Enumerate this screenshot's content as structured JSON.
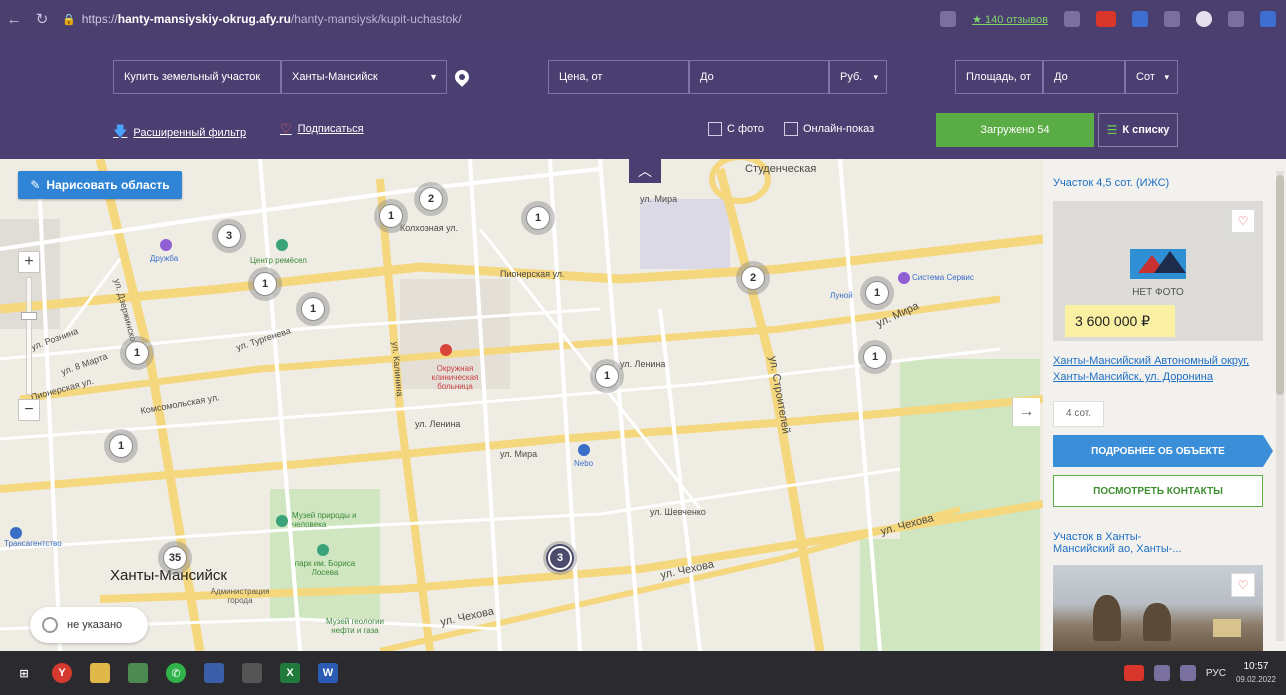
{
  "browser": {
    "url_prefix": "https://",
    "url_host": "hanty-mansiyskiy-okrug.afy.ru",
    "url_path": "/hanty-mansiysk/kupit-uchastok/",
    "reviews_label": "★ 140 отзывов"
  },
  "filters": {
    "deal_type": "Купить земельный участок",
    "city": "Ханты-Мансийск",
    "price_from_placeholder": "Цена, от",
    "price_to_placeholder": "До",
    "currency": "Руб.",
    "area_from_placeholder": "Площадь, от",
    "area_to_placeholder": "До",
    "area_unit": "Сот",
    "advanced_filter": "Расширенный фильтр",
    "subscribe": "Подписаться",
    "with_photo": "С фото",
    "online_show": "Онлайн-показ",
    "loaded_label": "Загружено 54",
    "to_list": "К списку"
  },
  "map": {
    "draw_area": "Нарисовать область",
    "city_label": "Ханты-Мансийск",
    "status_label": "не указано",
    "clusters": [
      {
        "count": "3"
      },
      {
        "count": "2"
      },
      {
        "count": "1"
      },
      {
        "count": "1"
      },
      {
        "count": "1"
      },
      {
        "count": "1"
      },
      {
        "count": "2"
      },
      {
        "count": "1"
      },
      {
        "count": "1"
      },
      {
        "count": "1"
      },
      {
        "count": "1"
      },
      {
        "count": "1"
      },
      {
        "count": "35"
      },
      {
        "count": "3"
      }
    ],
    "streets": {
      "pionerskaya": "Пионерская ул.",
      "studencheskaya": "Студенческая",
      "kolkhoznaya": "Колхозная ул.",
      "mira1": "ул. Мира",
      "mira2": "ул. Мира",
      "chekhova1": "ул. Чехова",
      "chekhova2": "ул. Чехова",
      "chekhova3": "ул. Чехова",
      "komsomolskaya": "Комсомольская ул.",
      "lenina": "ул. Ленина",
      "lenina2": "ул. Ленина",
      "stroiteley": "ул. Строителей",
      "kalinina": "ул. Калинина",
      "dzerzhinskogo": "ул. Дзержинского",
      "pionerskaya2": "Пионерская ул.",
      "shevchenko": "ул. Шевченко",
      "rozhnina": "ул. Рознина",
      "turgeneva": "ул. Тургенева",
      "marta8": "ул. 8 Марта",
      "mira3": "ул. Мира"
    },
    "pois": {
      "druzhba": "Дружба",
      "crafts": "Центр ремёсел",
      "hospital": "Окружная клиническая больница",
      "museum": "Музей природы и человека",
      "park": "парк им. Бориса Лосева",
      "admin": "Администрация города",
      "geology": "Музей геологии нефти и газа",
      "nebo": "Nebo",
      "service": "Система Сервис",
      "agency": "Трансагентство",
      "lunoy": "Луной"
    }
  },
  "listings": [
    {
      "title": "Участок 4,5 сот. (ИЖС)",
      "no_photo": "НЕТ ФОТО",
      "price": "3 600 000 ₽",
      "address_line1": "Ханты-Мансийский Автономный округ,",
      "address_line2": "Ханты-Мансийск, ул. Доронина",
      "area": "4 сот.",
      "more_btn": "ПОДРОБНЕЕ ОБ ОБЪЕКТЕ",
      "contacts_btn": "ПОСМОТРЕТЬ КОНТАКТЫ"
    },
    {
      "title_line1": "Участок в Ханты-",
      "title_line2": "Мансийский ао, Ханты-..."
    }
  ],
  "taskbar": {
    "lang": "РУС",
    "time": "10:57",
    "date": "09.02.2022"
  },
  "colors": {
    "header_bg": "#4b3f72",
    "accent_green": "#5aac44",
    "accent_blue": "#2f84d6",
    "price_bg": "#f9f0a4"
  }
}
